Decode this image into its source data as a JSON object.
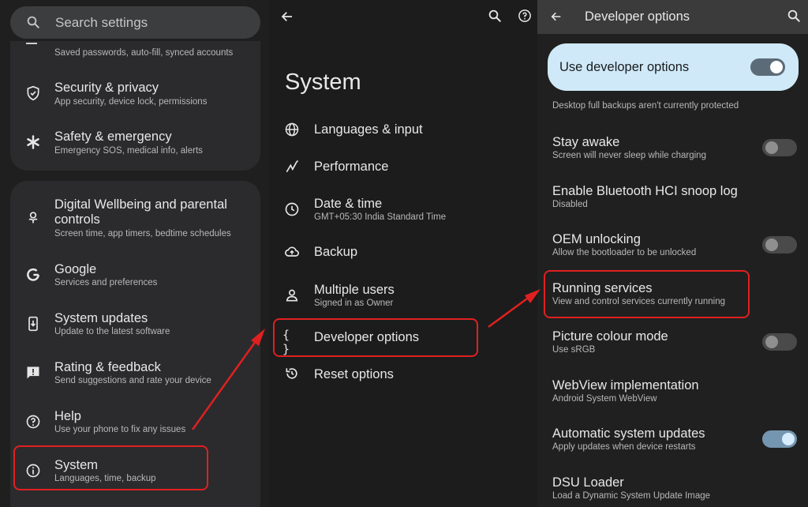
{
  "panel1": {
    "search_placeholder": "Search settings",
    "card1_partial": "Saved passwords, auto-fill, synced accounts",
    "card1_items": [
      {
        "title": "Security & privacy",
        "subtitle": "App security, device lock, permissions",
        "icon": "shield-icon"
      },
      {
        "title": "Safety & emergency",
        "subtitle": "Emergency SOS, medical info, alerts",
        "icon": "asterisk-icon"
      }
    ],
    "card2_items": [
      {
        "title_line1": "Digital Wellbeing and parental",
        "title_line2": "controls",
        "subtitle": "Screen time, app timers, bedtime schedules",
        "icon": "wellbeing-icon"
      },
      {
        "title": "Google",
        "subtitle": "Services and preferences",
        "icon": "google-icon"
      },
      {
        "title": "System updates",
        "subtitle": "Update to the latest software",
        "icon": "system-update-icon"
      },
      {
        "title": "Rating & feedback",
        "subtitle": "Send suggestions and rate your device",
        "icon": "feedback-icon"
      },
      {
        "title": "Help",
        "subtitle": "Use your phone to fix any issues",
        "icon": "help-icon"
      },
      {
        "title": "System",
        "subtitle": "Languages, time, backup",
        "icon": "info-icon"
      }
    ]
  },
  "panel2": {
    "title": "System",
    "items": [
      {
        "title": "Languages & input",
        "subtitle": "",
        "icon": "globe-icon"
      },
      {
        "title": "Performance",
        "subtitle": "",
        "icon": "performance-icon"
      },
      {
        "title": "Date & time",
        "subtitle": "GMT+05:30 India Standard Time",
        "icon": "clock-icon"
      },
      {
        "title": "Backup",
        "subtitle": "",
        "icon": "cloud-backup-icon"
      },
      {
        "title": "Multiple users",
        "subtitle": "Signed in as Owner",
        "icon": "person-icon"
      },
      {
        "title": "Developer options",
        "subtitle": "",
        "icon": "braces-icon"
      },
      {
        "title": "Reset options",
        "subtitle": "",
        "icon": "reset-icon"
      }
    ]
  },
  "panel3": {
    "header_title": "Developer options",
    "master_label": "Use developer options",
    "note": "Desktop full backups aren't currently protected",
    "items": [
      {
        "title": "Stay awake",
        "subtitle": "Screen will never sleep while charging",
        "toggle": "off"
      },
      {
        "title": "Enable Bluetooth HCI snoop log",
        "subtitle": "Disabled",
        "toggle": "none"
      },
      {
        "title": "OEM unlocking",
        "subtitle": "Allow the bootloader to be unlocked",
        "toggle": "off"
      },
      {
        "title": "Running services",
        "subtitle": "View and control services currently running",
        "toggle": "none"
      },
      {
        "title": "Picture colour mode",
        "subtitle": "Use sRGB",
        "toggle": "off"
      },
      {
        "title": "WebView implementation",
        "subtitle": "Android System WebView",
        "toggle": "none"
      },
      {
        "title": "Automatic system updates",
        "subtitle": "Apply updates when device restarts",
        "toggle": "on"
      },
      {
        "title": "DSU Loader",
        "subtitle": "Load a Dynamic System Update Image",
        "toggle": "none"
      }
    ]
  },
  "colors": {
    "highlight": "#e02020",
    "accent_card": "#cfe9f8"
  }
}
